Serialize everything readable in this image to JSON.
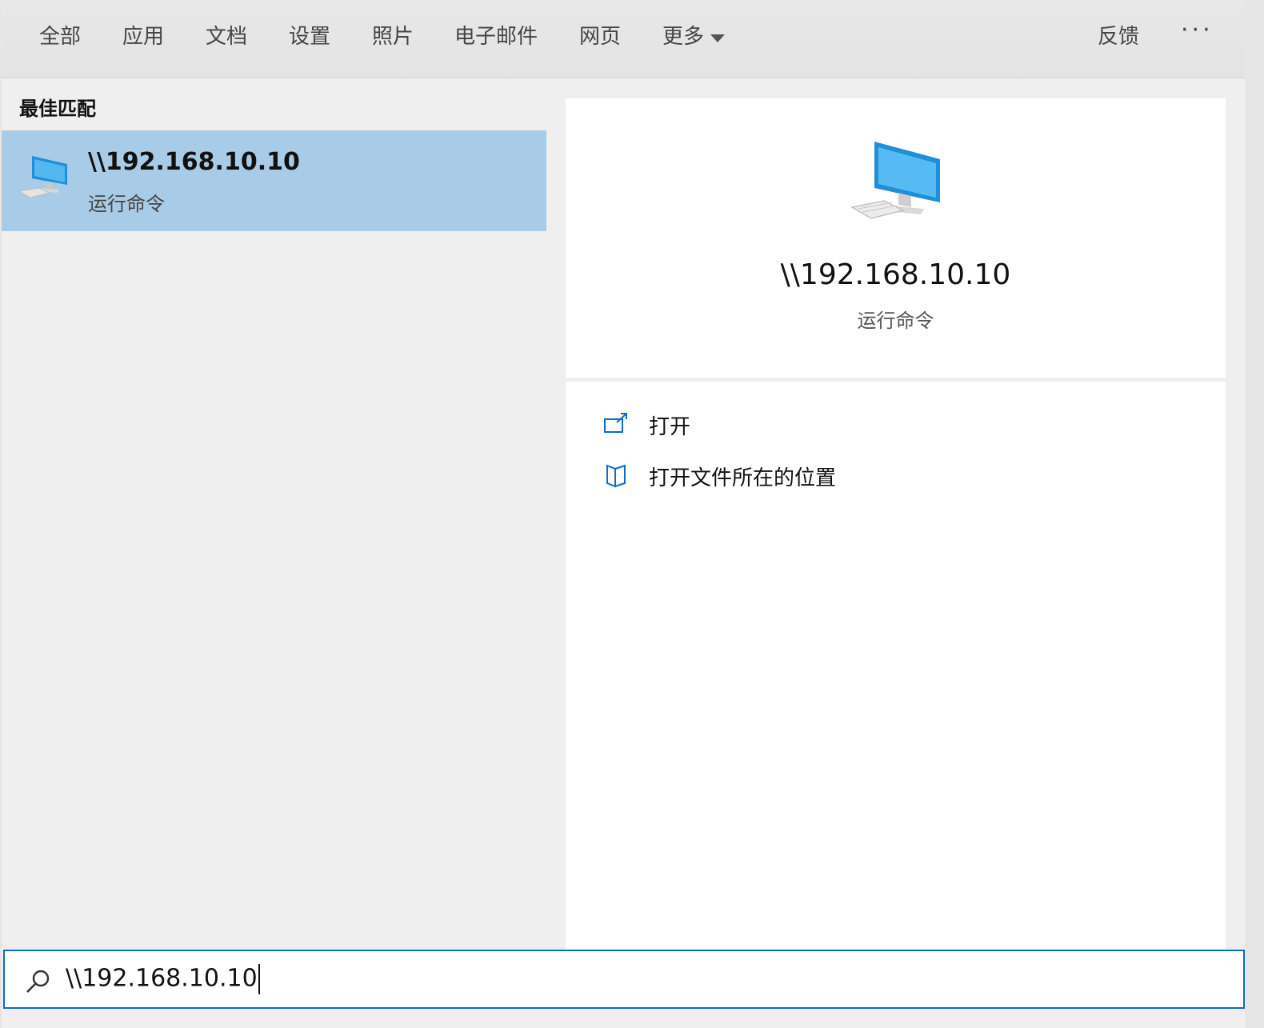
{
  "filters": {
    "tabs": [
      "全部",
      "应用",
      "文档",
      "设置",
      "照片",
      "电子邮件",
      "网页"
    ],
    "more_label": "更多",
    "feedback_label": "反馈",
    "overflow_label": "···"
  },
  "results": {
    "section_title": "最佳匹配",
    "best_match": {
      "title": "\\\\192.168.10.10",
      "subtitle": "运行命令",
      "icon": "computer-icon"
    }
  },
  "detail": {
    "title": "\\\\192.168.10.10",
    "subtitle": "运行命令",
    "icon": "computer-icon",
    "actions": [
      {
        "label": "打开",
        "icon": "open-external-icon"
      },
      {
        "label": "打开文件所在的位置",
        "icon": "folder-location-icon"
      }
    ]
  },
  "search": {
    "value": "\\\\192.168.10.10",
    "icon": "search-icon"
  },
  "colors": {
    "selection": "#a8cbe7",
    "accent": "#0a6ccc"
  }
}
